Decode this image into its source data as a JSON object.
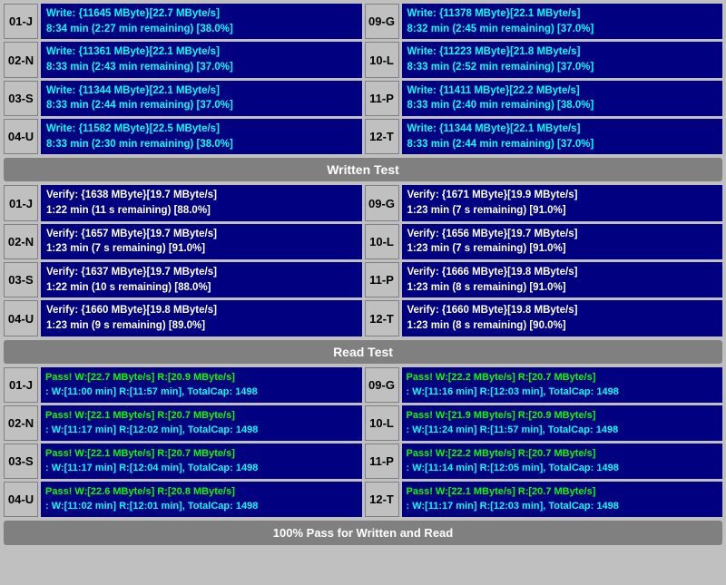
{
  "sections": {
    "write_test": {
      "label": "Written Test",
      "rows": [
        {
          "left_id": "01-J",
          "left_line1": "Write: {11645 MByte}[22.7 MByte/s]",
          "left_line2": "8:34 min (2:27 min remaining)  [38.0%]",
          "right_id": "09-G",
          "right_line1": "Write: {11378 MByte}[22.1 MByte/s]",
          "right_line2": "8:32 min (2:45 min remaining)  [37.0%]"
        },
        {
          "left_id": "02-N",
          "left_line1": "Write: {11361 MByte}[22.1 MByte/s]",
          "left_line2": "8:33 min (2:43 min remaining)  [37.0%]",
          "right_id": "10-L",
          "right_line1": "Write: {11223 MByte}[21.8 MByte/s]",
          "right_line2": "8:33 min (2:52 min remaining)  [37.0%]"
        },
        {
          "left_id": "03-S",
          "left_line1": "Write: {11344 MByte}[22.1 MByte/s]",
          "left_line2": "8:33 min (2:44 min remaining)  [37.0%]",
          "right_id": "11-P",
          "right_line1": "Write: {11411 MByte}[22.2 MByte/s]",
          "right_line2": "8:33 min (2:40 min remaining)  [38.0%]"
        },
        {
          "left_id": "04-U",
          "left_line1": "Write: {11582 MByte}[22.5 MByte/s]",
          "left_line2": "8:33 min (2:30 min remaining)  [38.0%]",
          "right_id": "12-T",
          "right_line1": "Write: {11344 MByte}[22.1 MByte/s]",
          "right_line2": "8:33 min (2:44 min remaining)  [37.0%]"
        }
      ]
    },
    "verify_test": {
      "rows": [
        {
          "left_id": "01-J",
          "left_line1": "Verify: {1638 MByte}[19.7 MByte/s]",
          "left_line2": "1:22 min (11 s remaining)  [88.0%]",
          "right_id": "09-G",
          "right_line1": "Verify: {1671 MByte}[19.9 MByte/s]",
          "right_line2": "1:23 min (7 s remaining)  [91.0%]"
        },
        {
          "left_id": "02-N",
          "left_line1": "Verify: {1657 MByte}[19.7 MByte/s]",
          "left_line2": "1:23 min (7 s remaining)  [91.0%]",
          "right_id": "10-L",
          "right_line1": "Verify: {1656 MByte}[19.7 MByte/s]",
          "right_line2": "1:23 min (7 s remaining)  [91.0%]"
        },
        {
          "left_id": "03-S",
          "left_line1": "Verify: {1637 MByte}[19.7 MByte/s]",
          "left_line2": "1:22 min (10 s remaining)  [88.0%]",
          "right_id": "11-P",
          "right_line1": "Verify: {1666 MByte}[19.8 MByte/s]",
          "right_line2": "1:23 min (8 s remaining)  [91.0%]"
        },
        {
          "left_id": "04-U",
          "left_line1": "Verify: {1660 MByte}[19.8 MByte/s]",
          "left_line2": "1:23 min (9 s remaining)  [89.0%]",
          "right_id": "12-T",
          "right_line1": "Verify: {1660 MByte}[19.8 MByte/s]",
          "right_line2": "1:23 min (8 s remaining)  [90.0%]"
        }
      ]
    },
    "read_test": {
      "label": "Read Test",
      "rows": [
        {
          "left_id": "01-J",
          "left_line1": "Pass! W:[22.7 MByte/s] R:[20.9 MByte/s]",
          "left_line2": "W:[11:00 min] R:[11:57 min], TotalCap: 1498",
          "right_id": "09-G",
          "right_line1": "Pass! W:[22.2 MByte/s] R:[20.7 MByte/s]",
          "right_line2": "W:[11:16 min] R:[12:03 min], TotalCap: 1498"
        },
        {
          "left_id": "02-N",
          "left_line1": "Pass! W:[22.1 MByte/s] R:[20.7 MByte/s]",
          "left_line2": "W:[11:17 min] R:[12:02 min], TotalCap: 1498",
          "right_id": "10-L",
          "right_line1": "Pass! W:[21.9 MByte/s] R:[20.9 MByte/s]",
          "right_line2": "W:[11:24 min] R:[11:57 min], TotalCap: 1498"
        },
        {
          "left_id": "03-S",
          "left_line1": "Pass! W:[22.1 MByte/s] R:[20.7 MByte/s]",
          "left_line2": "W:[11:17 min] R:[12:04 min], TotalCap: 1498",
          "right_id": "11-P",
          "right_line1": "Pass! W:[22.2 MByte/s] R:[20.7 MByte/s]",
          "right_line2": "W:[11:14 min] R:[12:05 min], TotalCap: 1498"
        },
        {
          "left_id": "04-U",
          "left_line1": "Pass! W:[22.6 MByte/s] R:[20.8 MByte/s]",
          "left_line2": "W:[11:02 min] R:[12:01 min], TotalCap: 1498",
          "right_id": "12-T",
          "right_line1": "Pass! W:[22.1 MByte/s] R:[20.7 MByte/s]",
          "right_line2": "W:[11:17 min] R:[12:03 min], TotalCap: 1498"
        }
      ]
    }
  },
  "dividers": {
    "written_test": "Written Test",
    "read_test": "Read Test"
  },
  "final_status": "100% Pass for Written and Read"
}
